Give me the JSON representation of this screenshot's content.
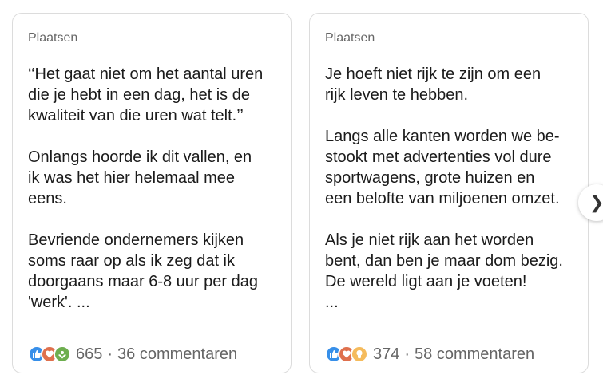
{
  "cards": [
    {
      "label": "Plaatsen",
      "paragraphs": [
        "‘‘Het gaat niet om het aantal uren\ndie je hebt in een dag, het is de\nkwaliteit van die uren wat telt.’’",
        "Onlangs hoorde ik dit vallen, en\nik was het hier helemaal mee\neens.",
        "Bevriende ondernemers kijken\nsoms raar op als ik zeg dat ik\ndoorgaans maar 6-8 uur per dag\n'werk'. ..."
      ],
      "reactions": [
        "like-icon",
        "love-icon",
        "support-icon"
      ],
      "reaction_count": "665",
      "comments": "36 commentaren"
    },
    {
      "label": "Plaatsen",
      "paragraphs": [
        "Je hoeft niet rijk te zijn om een\nrijk leven te hebben.",
        "Langs alle kanten worden we be-\nstookt met advertenties vol dure\nsportwagens, grote huizen en\neen belofte van miljoenen omzet.",
        "Als je niet rijk aan het worden\nbent, dan ben je maar dom bezig.\nDe wereld ligt aan je voeten!\n..."
      ],
      "reactions": [
        "like-icon",
        "love-icon",
        "insightful-icon"
      ],
      "reaction_count": "374",
      "comments": "58 commentaren"
    }
  ],
  "separator": "·",
  "next_button_glyph": "❯",
  "colors": {
    "like": "#378fe9",
    "love": "#df704d",
    "support": "#6dae4f",
    "insightful": "#f5bb5c"
  }
}
